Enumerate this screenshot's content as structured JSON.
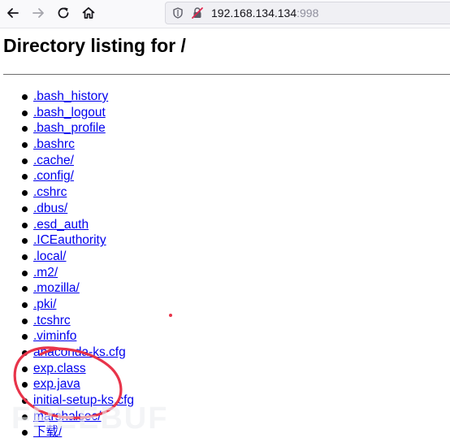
{
  "browser": {
    "url_host": "192.168.134.134",
    "url_port": ":998",
    "icons": [
      "back-arrow-icon",
      "forward-arrow-icon",
      "reload-icon",
      "home-icon",
      "tracking-shield-icon",
      "insecure-lock-icon"
    ]
  },
  "page": {
    "heading": "Directory listing for /",
    "files": [
      ".bash_history",
      ".bash_logout",
      ".bash_profile",
      ".bashrc",
      ".cache/",
      ".config/",
      ".cshrc",
      ".dbus/",
      ".esd_auth",
      ".ICEauthority",
      ".local/",
      ".m2/",
      ".mozilla/",
      ".pki/",
      ".tcshrc",
      ".viminfo",
      "anaconda-ks.cfg",
      "exp.class",
      "exp.java",
      "initial-setup-ks.cfg",
      "marshalsec/",
      "下载/"
    ]
  },
  "overlay": {
    "watermark_text": "FREEBUF",
    "annotation_color": "#e8344a"
  }
}
